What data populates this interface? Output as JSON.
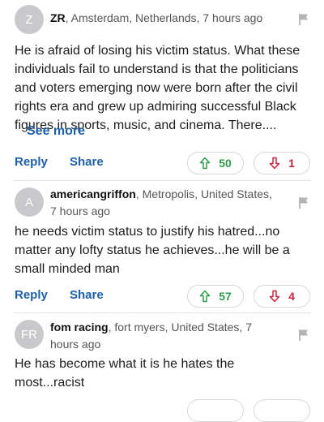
{
  "comments": [
    {
      "avatar": "Z",
      "author": "ZR",
      "meta": ", Amsterdam, Netherlands, 7 hours ago",
      "text": "He is afraid of losing his victim status. What these individuals fail to understand is that the politicians and voters emerging now were born after the civil rights era and grew up admiring successful Black figures in sports, music, and cinema. There....",
      "see_more": "See more",
      "reply": "Reply",
      "share": "Share",
      "upvotes": "50",
      "downvotes": "1"
    },
    {
      "avatar": "A",
      "author": "americangriffon",
      "meta": ", Metropolis, United States, 7 hours ago",
      "text": "he needs victim status to justify his hatred...no matter any lofty status he achieves...he will be a small minded man",
      "reply": "Reply",
      "share": "Share",
      "upvotes": "57",
      "downvotes": "4"
    },
    {
      "avatar": "FR",
      "author": "fom racing",
      "meta": ", fort myers, United States, 7 hours ago",
      "text": "He has become what it is he hates the most...racist"
    }
  ],
  "icons": {
    "flag": "flag-icon",
    "upvote": "arrow-up-icon",
    "downvote": "arrow-down-icon"
  },
  "colors": {
    "link": "#1f5fa8",
    "upvote": "#2e9a4a",
    "downvote": "#c8243c",
    "avatar": "#c9c9cc"
  }
}
